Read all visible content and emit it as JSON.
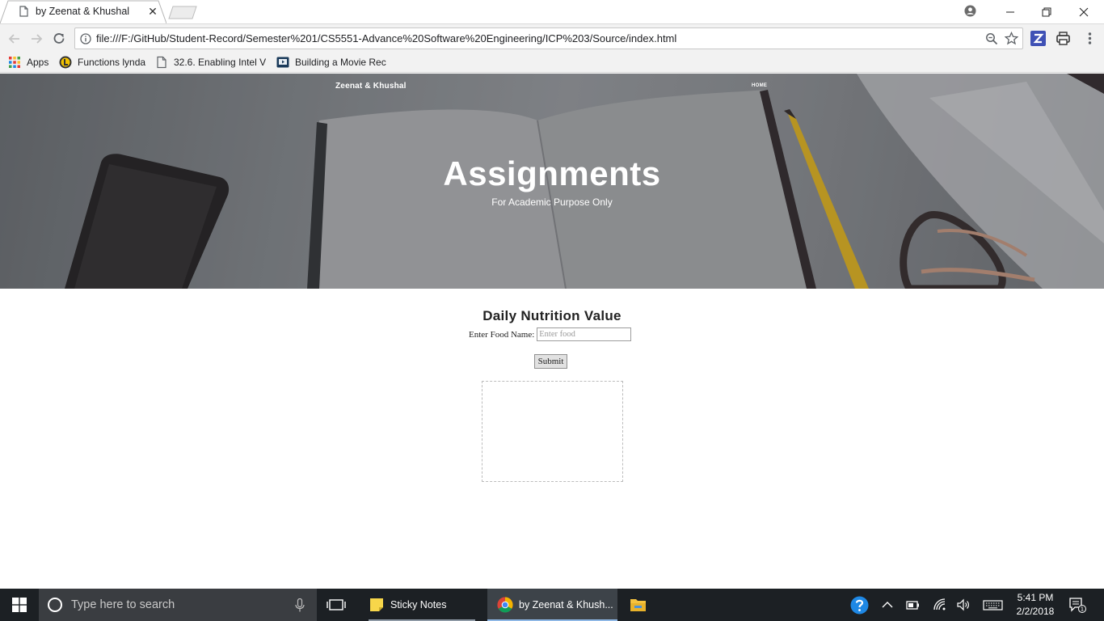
{
  "browser": {
    "tab_title": "by Zeenat & Khushal",
    "url": "file:///F:/GitHub/Student-Record/Semester%201/CS5551-Advance%20Software%20Engineering/ICP%203/Source/index.html",
    "bookmarks": [
      {
        "label": "Apps",
        "icon": "apps-grid-icon"
      },
      {
        "label": "Functions lynda",
        "icon": "lynda-icon"
      },
      {
        "label": "32.6. Enabling Intel V",
        "icon": "page-icon"
      },
      {
        "label": "Building a Movie Rec",
        "icon": "video-icon"
      }
    ]
  },
  "site": {
    "brand": "Zeenat & Khushal",
    "nav_home": "HOME",
    "hero_title": "Assignments",
    "hero_subtitle": "For Academic Purpose Only"
  },
  "form": {
    "section_title": "Daily Nutrition Value",
    "food_label": "Enter Food Name:",
    "food_placeholder": "Enter food",
    "food_value": "",
    "submit_label": "Submit"
  },
  "taskbar": {
    "search_placeholder": "Type here to search",
    "apps": [
      {
        "label": "Sticky Notes",
        "icon": "sticky-notes-icon",
        "active": false
      },
      {
        "label": "by Zeenat & Khush...",
        "icon": "chrome-icon",
        "active": true
      }
    ],
    "time": "5:41 PM",
    "date": "2/2/2018",
    "notification_count": "1"
  },
  "colors": {
    "chrome_toolbar": "#f2f2f2",
    "taskbar_bg": "#1c2024",
    "taskbar_search_bg": "#3a3d41",
    "active_task_underline": "#8fb8e6"
  }
}
